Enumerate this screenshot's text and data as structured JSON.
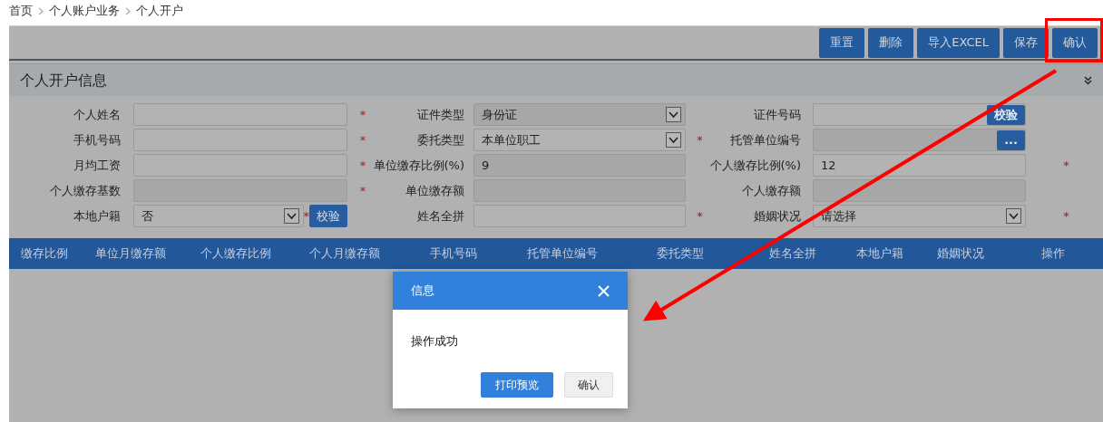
{
  "breadcrumb": [
    "首页",
    "个人账户业务",
    "个人开户"
  ],
  "toolbar": {
    "buttons": [
      "重置",
      "删除",
      "导入EXCEL",
      "保存",
      "确认"
    ]
  },
  "section": {
    "title": "个人开户信息"
  },
  "form": {
    "rows": [
      [
        {
          "label": "个人姓名",
          "kind": "text",
          "disabled": false,
          "required_mark": "*"
        },
        {
          "label": "证件类型",
          "kind": "select",
          "value": "身份证",
          "disabled": true
        },
        {
          "label": "证件号码",
          "kind": "text",
          "disabled": false,
          "button": "校验"
        }
      ],
      [
        {
          "label": "手机号码",
          "kind": "text",
          "disabled": false,
          "required_mark": "*"
        },
        {
          "label": "委托类型",
          "kind": "select",
          "value": "本单位职工",
          "disabled": false,
          "required_mark": "*"
        },
        {
          "label": "托管单位编号",
          "kind": "text",
          "disabled": true,
          "button": "..."
        }
      ],
      [
        {
          "label": "月均工资",
          "kind": "text",
          "disabled": false,
          "required_mark": "*"
        },
        {
          "label": "单位缴存比例(%)",
          "kind": "text",
          "value": "9",
          "disabled": true
        },
        {
          "label": "个人缴存比例(%)",
          "kind": "text",
          "value": "12",
          "disabled": false,
          "required_mark": "*"
        }
      ],
      [
        {
          "label": "个人缴存基数",
          "kind": "text",
          "disabled": true,
          "required_mark": "*"
        },
        {
          "label": "单位缴存额",
          "kind": "text",
          "disabled": true
        },
        {
          "label": "个人缴存额",
          "kind": "text",
          "disabled": true
        }
      ],
      [
        {
          "label": "本地户籍",
          "kind": "select",
          "value": "否",
          "disabled": false,
          "required_mark": "*",
          "button": "校验"
        },
        {
          "label": "姓名全拼",
          "kind": "text",
          "disabled": false,
          "required_mark": "*"
        },
        {
          "label": "婚姻状况",
          "kind": "select",
          "value": "请选择",
          "disabled": false,
          "required_mark": "*"
        }
      ]
    ]
  },
  "table": {
    "columns": [
      "缴存比例",
      "单位月缴存额",
      "个人缴存比例",
      "个人月缴存额",
      "手机号码",
      "托管单位编号",
      "委托类型",
      "姓名全拼",
      "本地户籍",
      "婚姻状况",
      "操作"
    ]
  },
  "dialog": {
    "title": "信息",
    "message": "操作成功",
    "buttons": [
      {
        "label": "打印预览",
        "kind": "primary"
      },
      {
        "label": "确认",
        "kind": "default"
      }
    ]
  }
}
